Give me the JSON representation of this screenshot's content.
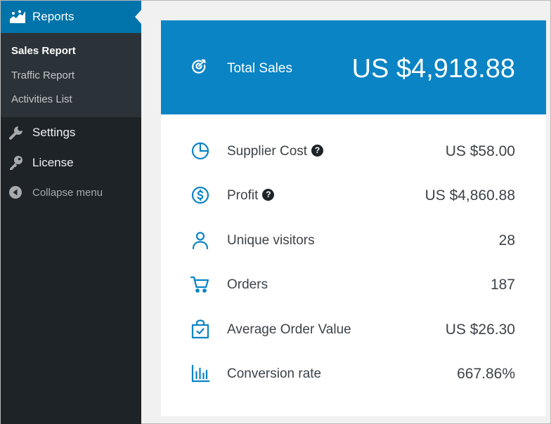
{
  "sidebar": {
    "active": {
      "label": "Reports",
      "icon": "chart-area-icon"
    },
    "submenu": [
      {
        "label": "Sales Report",
        "current": true
      },
      {
        "label": "Traffic Report",
        "current": false
      },
      {
        "label": "Activities List",
        "current": false
      }
    ],
    "items": [
      {
        "label": "Settings",
        "icon": "wrench-icon"
      },
      {
        "label": "License",
        "icon": "key-icon"
      },
      {
        "label": "Collapse menu",
        "icon": "collapse-arrow-icon"
      }
    ]
  },
  "colors": {
    "sidebar_bg": "#1d2327",
    "submenu_bg": "#2c3338",
    "active_menu": "#0073aa",
    "header_bg": "#0a84c4",
    "icon_blue": "#0a84c4",
    "text": "#3c434a"
  },
  "summary": {
    "label": "Total Sales",
    "value": "US $4,918.88",
    "icon": "target-icon"
  },
  "stats": [
    {
      "label": "Supplier Cost",
      "value": "US $58.00",
      "icon": "pie-chart-icon",
      "help": true,
      "help_glyph": "?"
    },
    {
      "label": "Profit",
      "value": "US $4,860.88",
      "icon": "dollar-circle-icon",
      "help": true,
      "help_glyph": "?"
    },
    {
      "label": "Unique visitors",
      "value": "28",
      "icon": "user-icon",
      "help": false
    },
    {
      "label": "Orders",
      "value": "187",
      "icon": "cart-icon",
      "help": false
    },
    {
      "label": "Average Order Value",
      "value": "US $26.30",
      "icon": "shopping-bag-check-icon",
      "help": false
    },
    {
      "label": "Conversion rate",
      "value": "667.86%",
      "icon": "bar-chart-icon",
      "help": false
    }
  ]
}
